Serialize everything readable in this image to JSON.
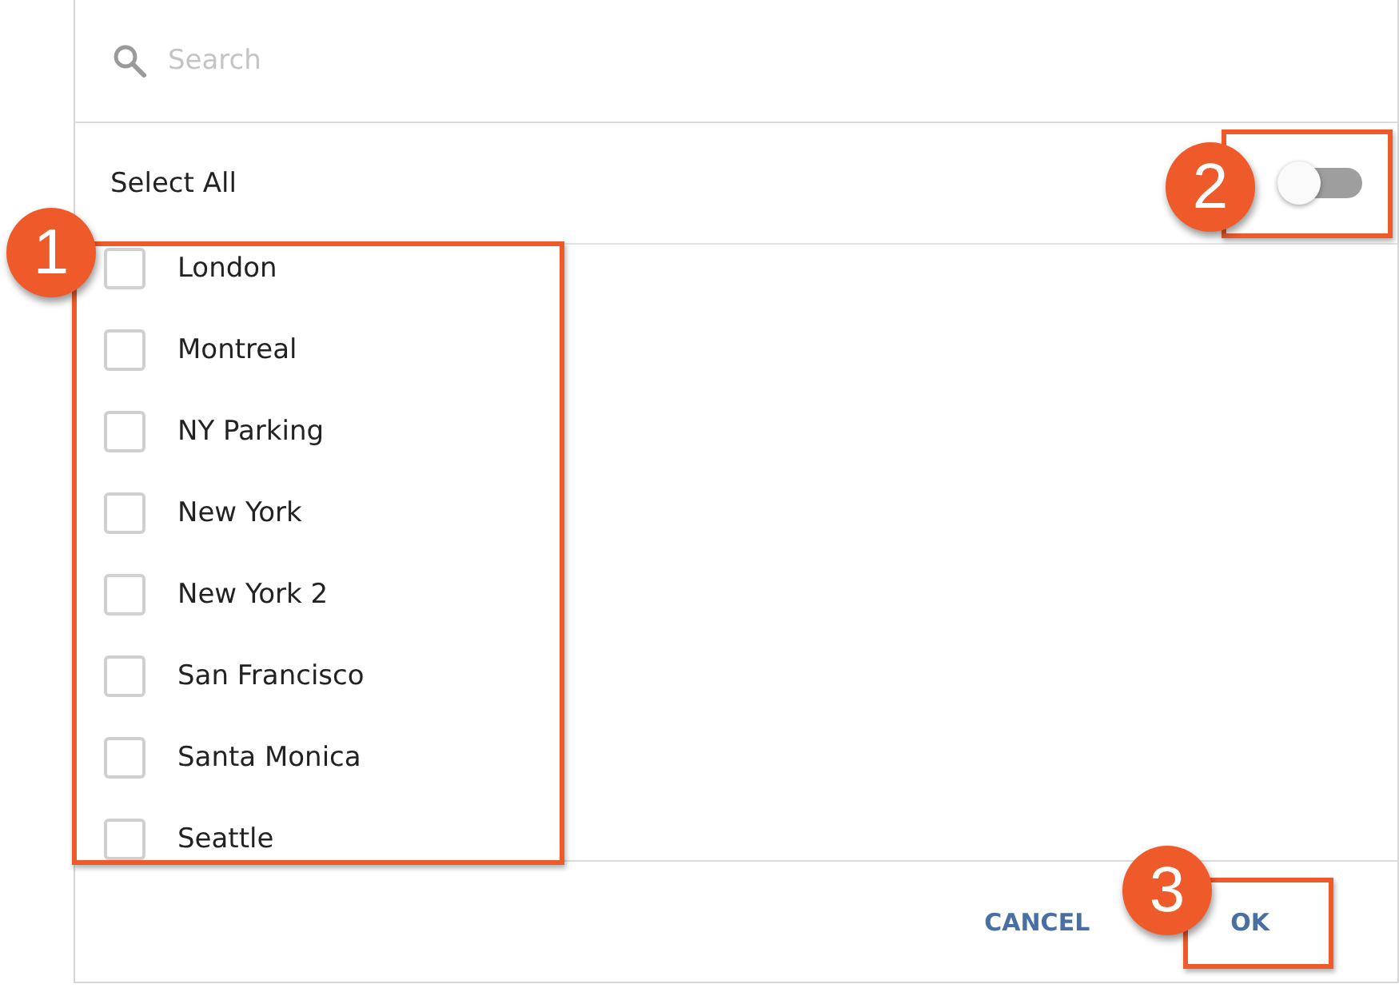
{
  "search": {
    "placeholder": "Search"
  },
  "select_all": {
    "label": "Select All",
    "on": false
  },
  "items": [
    {
      "label": "London",
      "checked": false
    },
    {
      "label": "Montreal",
      "checked": false
    },
    {
      "label": "NY Parking",
      "checked": false
    },
    {
      "label": "New York",
      "checked": false
    },
    {
      "label": "New York 2",
      "checked": false
    },
    {
      "label": "San Francisco",
      "checked": false
    },
    {
      "label": "Santa Monica",
      "checked": false
    },
    {
      "label": "Seattle",
      "checked": false
    }
  ],
  "buttons": [
    {
      "label": "CANCEL"
    },
    {
      "label": "OK"
    }
  ],
  "callouts": [
    {
      "number": "1"
    },
    {
      "number": "2"
    },
    {
      "number": "3"
    }
  ]
}
